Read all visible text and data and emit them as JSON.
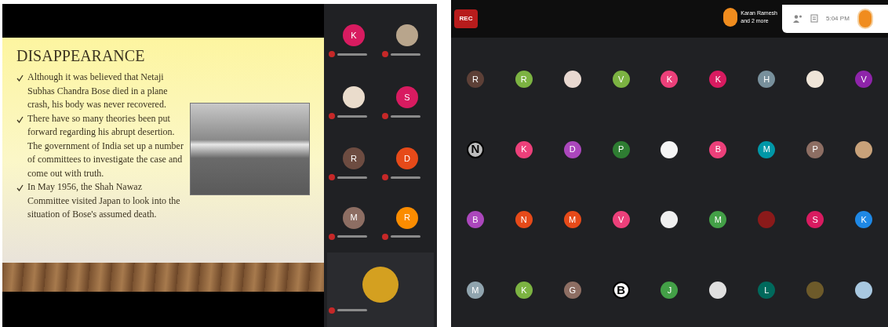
{
  "slide": {
    "title": "DISAPPEARANCE",
    "bullets": [
      "Although it was believed that Netaji Subhas Chandra Bose died in a plane crash, his body was never recovered.",
      "There have so many theories been put forward regarding his abrupt desertion. The government of India set up a number of committees to investigate the case and come out with truth.",
      "In May 1956, the Shah Nawaz Committee visited Japan to look into the situation of Bose's assumed death."
    ]
  },
  "side_participants": [
    {
      "kind": "letter",
      "letter": "K",
      "color": "#d81b60"
    },
    {
      "kind": "photo",
      "color": "#b8a58c"
    },
    {
      "kind": "photo",
      "color": "#eadccc"
    },
    {
      "kind": "letter",
      "letter": "S",
      "color": "#d81b60"
    },
    {
      "kind": "letter",
      "letter": "R",
      "color": "#6d4c41"
    },
    {
      "kind": "letter",
      "letter": "D",
      "color": "#e64a19"
    },
    {
      "kind": "letter",
      "letter": "M",
      "color": "#8d6e63"
    },
    {
      "kind": "letter",
      "letter": "R",
      "color": "#fb8c00"
    },
    {
      "kind": "photo",
      "color": "#d4a020"
    }
  ],
  "meeting_bar": {
    "rec": "REC",
    "presenter_line1": "Karan Ramesh",
    "presenter_line2": "and 2 more",
    "time": "5:04 PM"
  },
  "grid": [
    {
      "kind": "letter",
      "letter": "R",
      "color": "#5d4037"
    },
    {
      "kind": "letter",
      "letter": "R",
      "color": "#7cb342"
    },
    {
      "kind": "photo",
      "color": "#e8d8d0"
    },
    {
      "kind": "letter",
      "letter": "V",
      "color": "#7cb342"
    },
    {
      "kind": "letter",
      "letter": "K",
      "color": "#ec407a"
    },
    {
      "kind": "letter",
      "letter": "K",
      "color": "#d81b60"
    },
    {
      "kind": "letter",
      "letter": "H",
      "color": "#78909c"
    },
    {
      "kind": "photo",
      "color": "#efe5d8"
    },
    {
      "kind": "letter",
      "letter": "V",
      "color": "#8e24aa"
    },
    {
      "kind": "logo",
      "letter": "N",
      "color": "#bdbdbd"
    },
    {
      "kind": "letter",
      "letter": "K",
      "color": "#ec407a"
    },
    {
      "kind": "letter",
      "letter": "D",
      "color": "#ab47bc"
    },
    {
      "kind": "letter",
      "letter": "P",
      "color": "#2e7d32"
    },
    {
      "kind": "photo",
      "color": "#f5f5f5"
    },
    {
      "kind": "letter",
      "letter": "B",
      "color": "#ec407a"
    },
    {
      "kind": "letter",
      "letter": "M",
      "color": "#0097a7"
    },
    {
      "kind": "letter",
      "letter": "P",
      "color": "#8d6e63"
    },
    {
      "kind": "photo",
      "color": "#c8a27a"
    },
    {
      "kind": "letter",
      "letter": "B",
      "color": "#ab47bc"
    },
    {
      "kind": "letter",
      "letter": "N",
      "color": "#e64a19"
    },
    {
      "kind": "letter",
      "letter": "M",
      "color": "#e64a19"
    },
    {
      "kind": "letter",
      "letter": "V",
      "color": "#ec407a"
    },
    {
      "kind": "photo",
      "color": "#f0f0f0"
    },
    {
      "kind": "letter",
      "letter": "M",
      "color": "#43a047"
    },
    {
      "kind": "photo",
      "color": "#8b1a1a"
    },
    {
      "kind": "letter",
      "letter": "S",
      "color": "#d81b60"
    },
    {
      "kind": "letter",
      "letter": "K",
      "color": "#1e88e5"
    },
    {
      "kind": "letter",
      "letter": "M",
      "color": "#90a4ae"
    },
    {
      "kind": "letter",
      "letter": "K",
      "color": "#7cb342"
    },
    {
      "kind": "letter",
      "letter": "G",
      "color": "#8d6e63"
    },
    {
      "kind": "logo",
      "letter": "B",
      "color": "#ffffff"
    },
    {
      "kind": "letter",
      "letter": "J",
      "color": "#43a047"
    },
    {
      "kind": "photo",
      "color": "#e0e0e0"
    },
    {
      "kind": "letter",
      "letter": "L",
      "color": "#00695c"
    },
    {
      "kind": "photo",
      "color": "#6d5a2a"
    },
    {
      "kind": "photo",
      "color": "#a8c8e0"
    }
  ]
}
